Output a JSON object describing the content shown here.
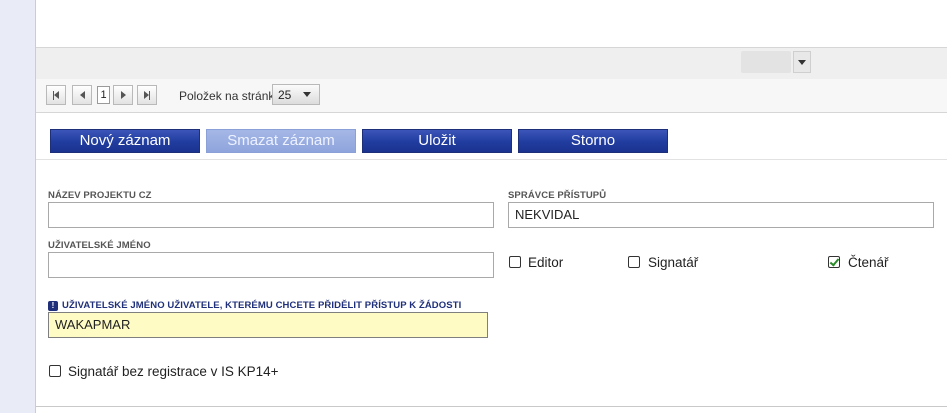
{
  "pager": {
    "current_page": "1",
    "per_page_label": "Položek na stránku",
    "per_page_value": "25"
  },
  "toolbar": {
    "new_label": "Nový záznam",
    "delete_label": "Smazat záznam",
    "save_label": "Uložit",
    "cancel_label": "Storno"
  },
  "form": {
    "project_name_label": "NÁZEV PROJEKTU CZ",
    "project_name_value": "",
    "access_admin_label": "SPRÁVCE PŘÍSTUPŮ",
    "access_admin_value": "NEKVIDAL",
    "username_label": "UŽIVATELSKÉ JMÉNO",
    "username_value": "",
    "roles": [
      {
        "label": "Editor",
        "checked": false
      },
      {
        "label": "Signatář",
        "checked": false
      },
      {
        "label": "Čtenář",
        "checked": true
      }
    ],
    "grant_user_label": "UŽIVATELSKÉ JMÉNO UŽIVATELE, KTERÉMU CHCETE PŘIDĚLIT PŘÍSTUP K ŽÁDOSTI",
    "grant_user_value": "WAKAPMAR",
    "unregistered_signatory_label": "Signatář bez registrace v IS KP14+",
    "unregistered_signatory_checked": false
  },
  "colors": {
    "primary_button": "#203c9e",
    "disabled_button": "#8ea4dc",
    "highlight_field": "#fffbc5",
    "checkmark": "#2a8a2a"
  }
}
